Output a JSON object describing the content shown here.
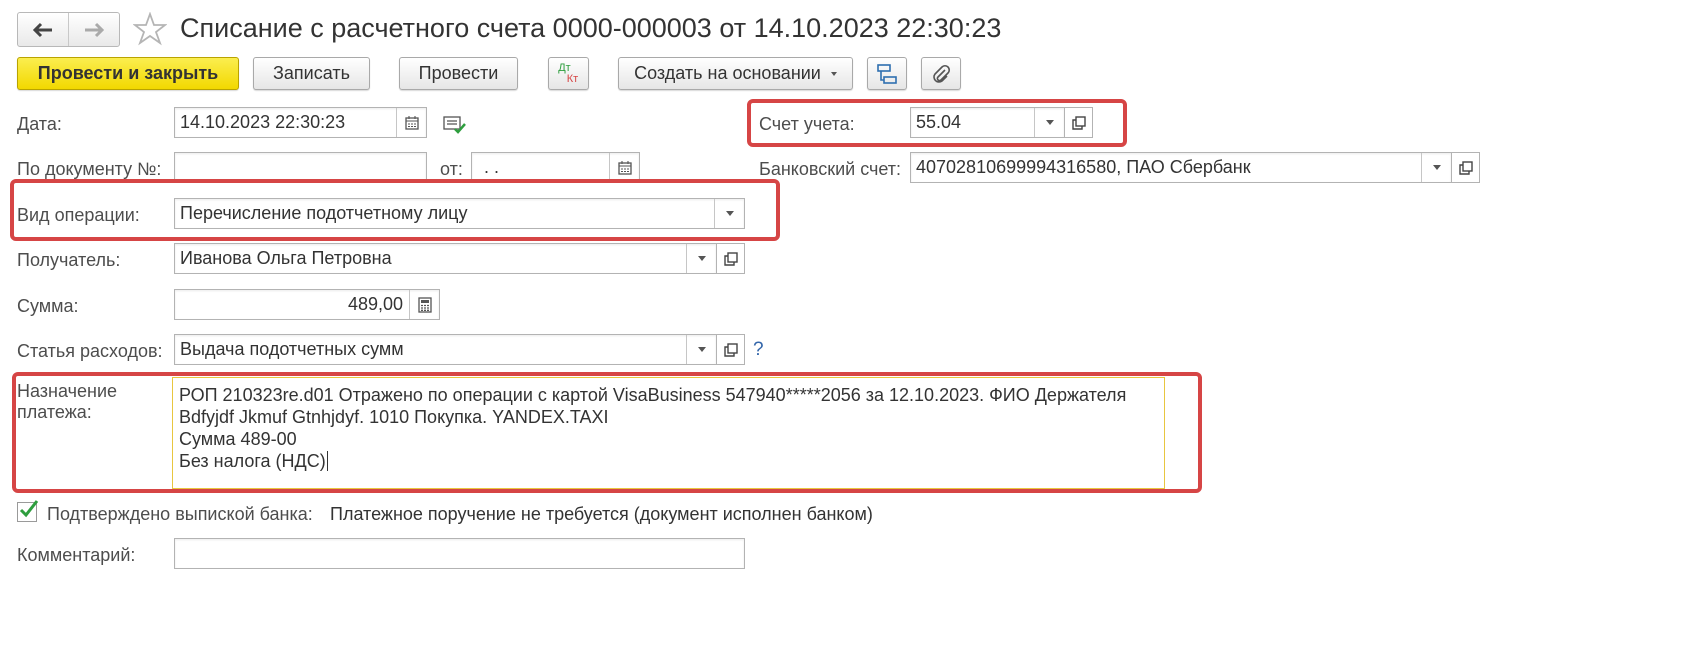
{
  "window": {
    "title": "Списание с расчетного счета 0000-000003 от 14.10.2023 22:30:23"
  },
  "toolbar": {
    "post_close_label": "Провести и закрыть",
    "save_label": "Записать",
    "post_label": "Провести",
    "dtkt_dt": "Дт",
    "dtkt_kt": "Кт",
    "create_based_label": "Создать на основании"
  },
  "form": {
    "date_label": "Дата:",
    "date_value": "14.10.2023 22:30:23",
    "doc_no_label": "По документу №:",
    "doc_no_value": "",
    "from_label": "от:",
    "from_value": " .  .",
    "account_label": "Счет учета:",
    "account_value": "55.04",
    "bank_account_label": "Банковский счет:",
    "bank_account_value": "40702810699994316580, ПАО Сбербанк",
    "operation_label": "Вид операции:",
    "operation_value": "Перечисление подотчетному лицу",
    "recipient_label": "Получатель:",
    "recipient_value": "Иванова Ольга Петровна",
    "amount_label": "Сумма:",
    "amount_value": "489,00",
    "expense_label": "Статья расходов:",
    "expense_value": "Выдача подотчетных сумм",
    "help_mark": "?",
    "purpose_label_line1": "Назначение",
    "purpose_label_line2": "платежа:",
    "purpose_lines": [
      "РОП 210323re.d01 Отражено по операции с картой VisaBusiness 547940*****2056 за 12.10.2023. ФИО Держателя",
      "Bdfyjdf Jkmuf Gtnhjdyf. 1010 Покупка. YANDEX.TAXI",
      "Сумма 489-00",
      "Без налога (НДС)"
    ],
    "confirmed_label": "Подтверждено выпиской банка:",
    "confirmed_checked": true,
    "confirmed_note": "Платежное поручение не требуется (документ исполнен банком)",
    "comment_label": "Комментарий:",
    "comment_value": ""
  },
  "colors": {
    "highlight_red": "#d64545",
    "primary_yellow": "#f2d800",
    "check_green": "#2e9e3e"
  },
  "icons": [
    "back-arrow-icon",
    "forward-arrow-icon",
    "favorite-star-icon",
    "dtkt-icon",
    "structure-icon",
    "paperclip-icon",
    "calendar-icon",
    "open-icon",
    "calculator-icon",
    "verified-list-icon",
    "checkmark-icon"
  ]
}
